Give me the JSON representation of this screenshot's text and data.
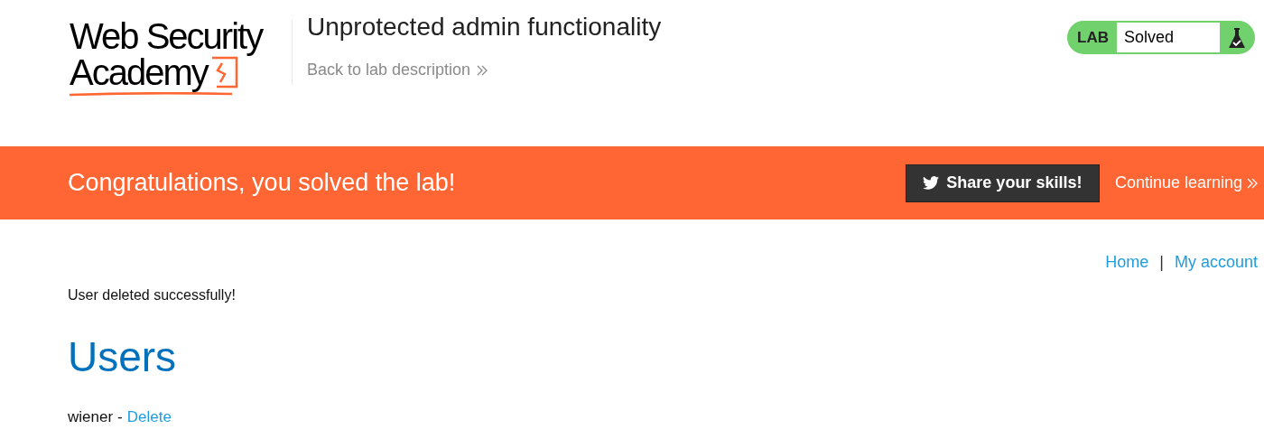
{
  "logo": {
    "line_1": "Web Security",
    "line_2": "Academy"
  },
  "lab": {
    "title": "Unprotected admin functionality",
    "back_link": "Back to lab description"
  },
  "lab_status": {
    "label": "LAB",
    "text": "Solved",
    "solved": true
  },
  "banner": {
    "message": "Congratulations, you solved the lab!",
    "share_button": "Share your skills!",
    "continue_link": "Continue learning"
  },
  "nav": {
    "links": [
      "Home",
      "My account"
    ],
    "separator": "|"
  },
  "message": "User deleted successfully!",
  "heading": "Users",
  "users": [
    {
      "name": "wiener",
      "separator": "-",
      "action": "Delete"
    }
  ]
}
